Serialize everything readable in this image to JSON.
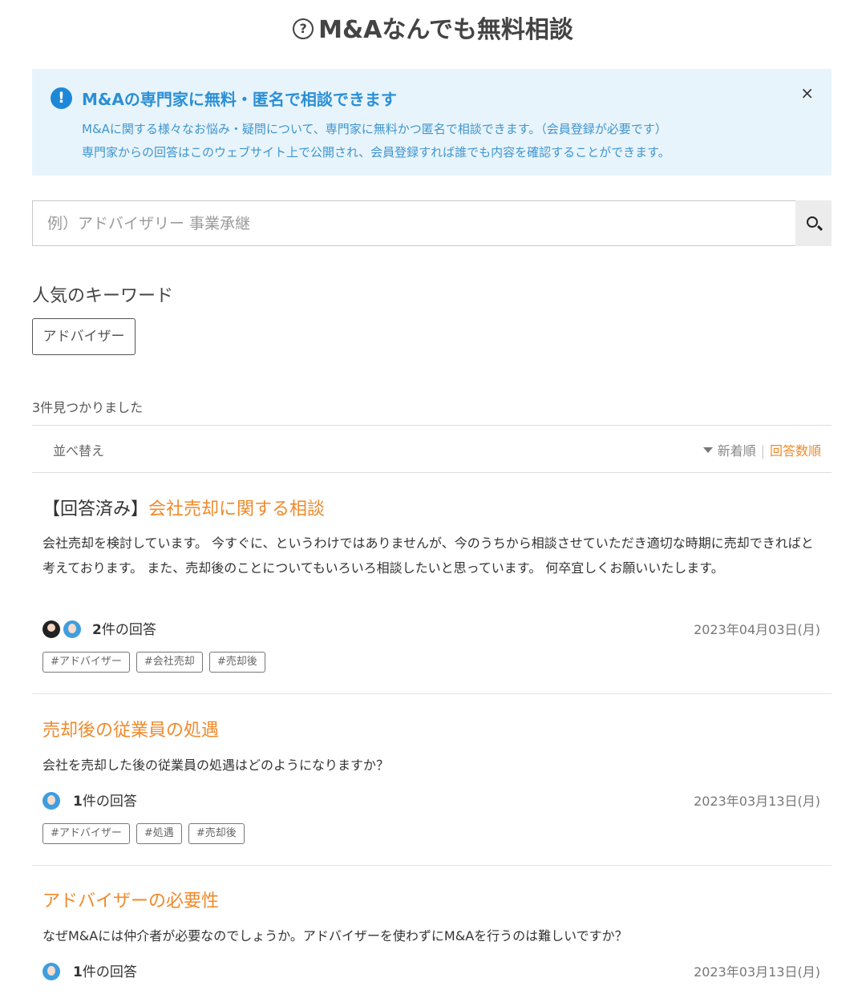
{
  "header": {
    "title": "M&Aなんでも無料相談",
    "icon": "question-circle-icon"
  },
  "notice": {
    "title": "M&Aの専門家に無料・匿名で相談できます",
    "line1": "M&Aに関する様々なお悩み・疑問について、専門家に無料かつ匿名で相談できます。（会員登録が必要です）",
    "line2": "専門家からの回答はこのウェブサイト上で公開され、会員登録すれば誰でも内容を確認することができます。",
    "close_label": "×",
    "accent_color": "#2b8fd6",
    "background_color": "#e8f4fb"
  },
  "search": {
    "placeholder": "例）アドバイザリー 事業承継",
    "value": ""
  },
  "keywords": {
    "heading": "人気のキーワード",
    "items": [
      "アドバイザー"
    ]
  },
  "results": {
    "count_text": "3件見つかりました",
    "sort": {
      "label": "並べ替え",
      "option_new": "新着順",
      "option_answers": "回答数順",
      "active": "回答数順"
    }
  },
  "questions": [
    {
      "prefix": "【回答済み】",
      "title": "会社売却に関する相談",
      "body": "会社売却を検討しています。 今すぐに、というわけではありませんが、今のうちから相談させていただき適切な時期に売却できればと考えております。 また、売却後のことについてもいろいろ相談したいと思っています。 何卒宜しくお願いいたします。",
      "answer_num": "2",
      "answer_suffix": "件の回答",
      "date": "2023年04月03日(月)",
      "tags": [
        "#アドバイザー",
        "#会社売却",
        "#売却後"
      ]
    },
    {
      "prefix": "",
      "title": "売却後の従業員の処遇",
      "body": "会社を売却した後の従業員の処遇はどのようになりますか？",
      "answer_num": "1",
      "answer_suffix": "件の回答",
      "date": "2023年03月13日(月)",
      "tags": [
        "#アドバイザー",
        "#処遇",
        "#売却後"
      ]
    },
    {
      "prefix": "",
      "title": "アドバイザーの必要性",
      "body": "なぜM&Aには仲介者が必要なのでしょうか。アドバイザーを使わずにM&Aを行うのは難しいですか？",
      "answer_num": "1",
      "answer_suffix": "件の回答",
      "date": "2023年03月13日(月)",
      "tags": []
    }
  ],
  "colors": {
    "link_orange": "#ef8a2b",
    "info_blue": "#1e88d8"
  }
}
